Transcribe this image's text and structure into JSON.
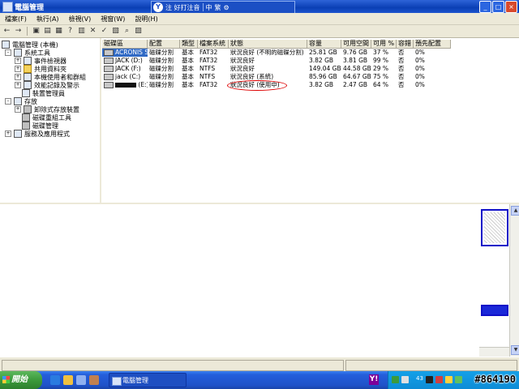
{
  "window": {
    "title": "電腦管理"
  },
  "ime": {
    "logo": "Y",
    "label": "注 好打注音",
    "mode": "中",
    "punct": "繁"
  },
  "menu": [
    {
      "label": "檔案(F)"
    },
    {
      "label": "執行(A)"
    },
    {
      "label": "檢視(V)"
    },
    {
      "label": "視窗(W)"
    },
    {
      "label": "說明(H)"
    }
  ],
  "tree": [
    {
      "label": "電腦管理 (本機)",
      "depth": 0,
      "icon": "computer-icon",
      "expander": ""
    },
    {
      "label": "系統工具",
      "depth": 1,
      "icon": "tools-icon",
      "expander": "-"
    },
    {
      "label": "事件檢視器",
      "depth": 2,
      "icon": "event-viewer-icon",
      "expander": "+"
    },
    {
      "label": "共用資料夾",
      "depth": 2,
      "icon": "shared-folder-icon",
      "expander": "+"
    },
    {
      "label": "本機使用者和群組",
      "depth": 2,
      "icon": "users-icon",
      "expander": "+"
    },
    {
      "label": "效能記錄及警示",
      "depth": 2,
      "icon": "performance-icon",
      "expander": "+"
    },
    {
      "label": "裝置管理員",
      "depth": 2,
      "icon": "device-manager-icon",
      "expander": ""
    },
    {
      "label": "存放",
      "depth": 1,
      "icon": "storage-icon",
      "expander": "-"
    },
    {
      "label": "卸除式存放裝置",
      "depth": 2,
      "icon": "removable-storage-icon",
      "expander": "+"
    },
    {
      "label": "磁碟重組工具",
      "depth": 2,
      "icon": "defrag-icon",
      "expander": ""
    },
    {
      "label": "磁碟管理",
      "depth": 2,
      "icon": "disk-management-icon",
      "expander": ""
    },
    {
      "label": "服務及應用程式",
      "depth": 1,
      "icon": "services-icon",
      "expander": "+"
    }
  ],
  "columns": [
    "磁碟區",
    "配置",
    "類型",
    "檔案系統",
    "狀態",
    "容量",
    "可用空間",
    "可用 %",
    "容錯",
    "預先配置"
  ],
  "rows": [
    [
      "ACRONIS SZ",
      "磁碟分割",
      "基本",
      "FAT32",
      "狀況良好 (不明的磁碟分割)",
      "25.81 GB",
      "9.76 GB",
      "37 %",
      "否",
      "0%"
    ],
    [
      "JACK (D:)",
      "磁碟分割",
      "基本",
      "FAT32",
      "狀況良好",
      "3.82 GB",
      "3.81 GB",
      "99 %",
      "否",
      "0%"
    ],
    [
      "JACK (F:)",
      "磁碟分割",
      "基本",
      "NTFS",
      "狀況良好",
      "149.04 GB",
      "44.58 GB",
      "29 %",
      "否",
      "0%"
    ],
    [
      "jack (C:)",
      "磁碟分割",
      "基本",
      "NTFS",
      "狀況良好 (系統)",
      "85.96 GB",
      "64.67 GB",
      "75 %",
      "否",
      "0%"
    ],
    [
      "(E:)",
      "磁碟分割",
      "基本",
      "FAT32",
      "狀況良好 (使用中)",
      "3.82 GB",
      "2.47 GB",
      "64 %",
      "否",
      "0%"
    ]
  ],
  "taskbar": {
    "start_label": "開始",
    "task_label": "電腦管理",
    "yahoo": "Y!",
    "tray_num": "43"
  },
  "watermark": "#864190",
  "colors": {
    "title_blue": "#0a3fb4",
    "selection": "#316ac5",
    "xp_green": "#3c9a3c",
    "highlight_red": "#dd0000"
  }
}
